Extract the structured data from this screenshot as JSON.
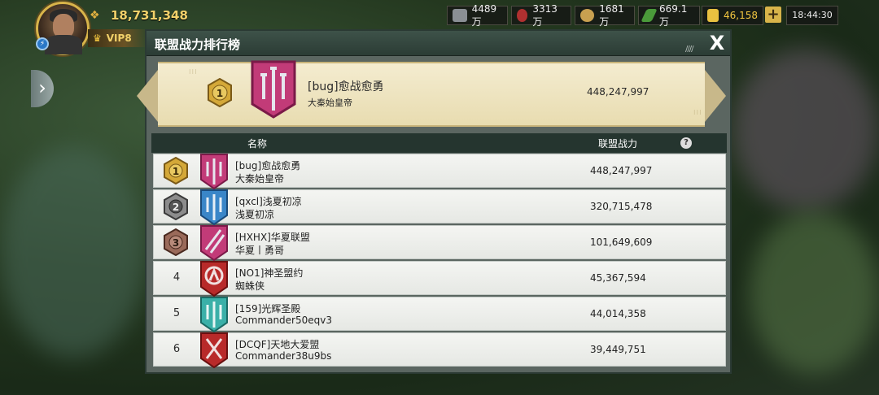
{
  "hud": {
    "player_power": "18,731,348",
    "vip": "VIP8",
    "resources": [
      {
        "name": "steel",
        "value": "4489万",
        "icon": "steel-icon",
        "color": "#8a8f94"
      },
      {
        "name": "oil",
        "value": "3313万",
        "icon": "oil-icon",
        "color": "#b03030"
      },
      {
        "name": "food",
        "value": "1681万",
        "icon": "food-icon",
        "color": "#c8a050"
      },
      {
        "name": "ammo",
        "value": "669.1万",
        "icon": "ammo-icon",
        "color": "#4a9a3a"
      },
      {
        "name": "gold",
        "value": "46,158",
        "icon": "gold-icon",
        "color": "#e8c040"
      }
    ],
    "time": "18:44:30"
  },
  "panel": {
    "title": "联盟战力排行榜",
    "close": "X",
    "top": {
      "rank": "1",
      "name": "[bug]愈战愈勇",
      "leader": "大秦始皇帝",
      "power": "448,247,997"
    },
    "columns": {
      "name": "名称",
      "power": "联盟战力",
      "help": "?"
    },
    "rows": [
      {
        "rank": "1",
        "name": "[bug]愈战愈勇",
        "leader": "大秦始皇帝",
        "power": "448,247,997",
        "medal": "gold",
        "flag": "pink-trident"
      },
      {
        "rank": "2",
        "name": "[qxcl]浅夏初凉",
        "leader": "浅夏初凉",
        "power": "320,715,478",
        "medal": "silver",
        "flag": "blue-trident"
      },
      {
        "rank": "3",
        "name": "[HXHX]华夏联盟",
        "leader": "华夏丨勇哥",
        "power": "101,649,609",
        "medal": "bronze",
        "flag": "pink-slash"
      },
      {
        "rank": "4",
        "name": "[NO1]神圣盟约",
        "leader": "蜘蛛侠",
        "power": "45,367,594",
        "medal": "none",
        "flag": "red-horse"
      },
      {
        "rank": "5",
        "name": "[159]光辉圣殿",
        "leader": "Commander50eqv3",
        "power": "44,014,358",
        "medal": "none",
        "flag": "teal-trident"
      },
      {
        "rank": "6",
        "name": "[DCQF]天地大爱盟",
        "leader": "Commander38u9bs",
        "power": "39,449,751",
        "medal": "none",
        "flag": "red-swords"
      }
    ]
  },
  "colors": {
    "gold": "#d4a838",
    "silver": "#8c8c8c",
    "bronze": "#9a6a5a",
    "header": "#2b3c35"
  }
}
